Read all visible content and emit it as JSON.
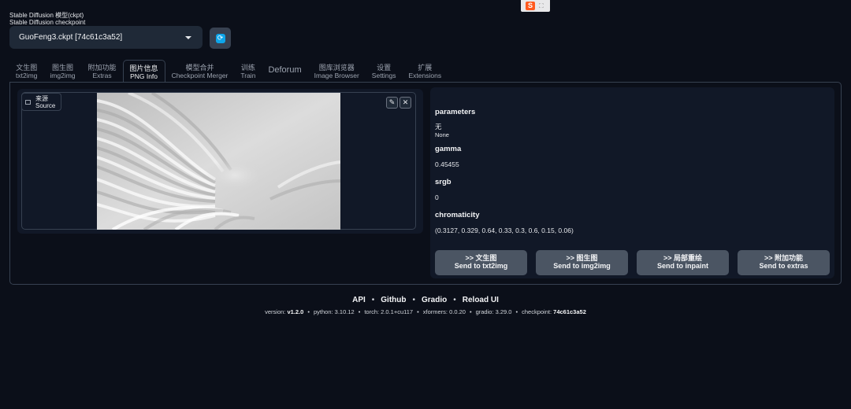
{
  "model": {
    "label_cn": "Stable Diffusion 模型(ckpt)",
    "label_en": "Stable Diffusion checkpoint",
    "selected": "GuoFeng3.ckpt [74c61c3a52]",
    "refresh_icon": "refresh-icon"
  },
  "tabs": [
    {
      "cn": "文生图",
      "en": "txt2img"
    },
    {
      "cn": "图生图",
      "en": "img2img"
    },
    {
      "cn": "附加功能",
      "en": "Extras"
    },
    {
      "cn": "图片信息",
      "en": "PNG Info"
    },
    {
      "cn": "模型合并",
      "en": "Checkpoint Merger"
    },
    {
      "cn": "训练",
      "en": "Train"
    },
    {
      "cn": "Deforum",
      "en": ""
    },
    {
      "cn": "图库浏览器",
      "en": "Image Browser"
    },
    {
      "cn": "设置",
      "en": "Settings"
    },
    {
      "cn": "扩展",
      "en": "Extensions"
    }
  ],
  "active_tab": "PNG Info",
  "source": {
    "label_cn": "来源",
    "label_en": "Source"
  },
  "info": {
    "parameters_key": "parameters",
    "parameters_cn": "无",
    "parameters_en": "None",
    "gamma_key": "gamma",
    "gamma_val": "0.45455",
    "srgb_key": "srgb",
    "srgb_val": "0",
    "chromaticity_key": "chromaticity",
    "chromaticity_val": "(0.3127, 0.329, 0.64, 0.33, 0.3, 0.6, 0.15, 0.06)"
  },
  "send_buttons": [
    {
      "cn": ">> 文生图",
      "en": "Send to txt2img"
    },
    {
      "cn": ">> 图生图",
      "en": "Send to img2img"
    },
    {
      "cn": ">> 局部重绘",
      "en": "Send to inpaint"
    },
    {
      "cn": ">> 附加功能",
      "en": "Send to extras"
    }
  ],
  "footer": {
    "links": [
      "API",
      "Github",
      "Gradio",
      "Reload UI"
    ],
    "version_label": "version:",
    "version": "v1.2.0",
    "python": "python: 3.10.12",
    "torch": "torch: 2.0.1+cu117",
    "xformers": "xformers: 0.0.20",
    "gradio": "gradio: 3.29.0",
    "checkpoint_label": "checkpoint:",
    "checkpoint": "74c61c3a52"
  },
  "colors": {
    "background": "#0b0f19",
    "panel": "#111827",
    "button": "#4b5563",
    "accent": "#0ea5e9"
  }
}
